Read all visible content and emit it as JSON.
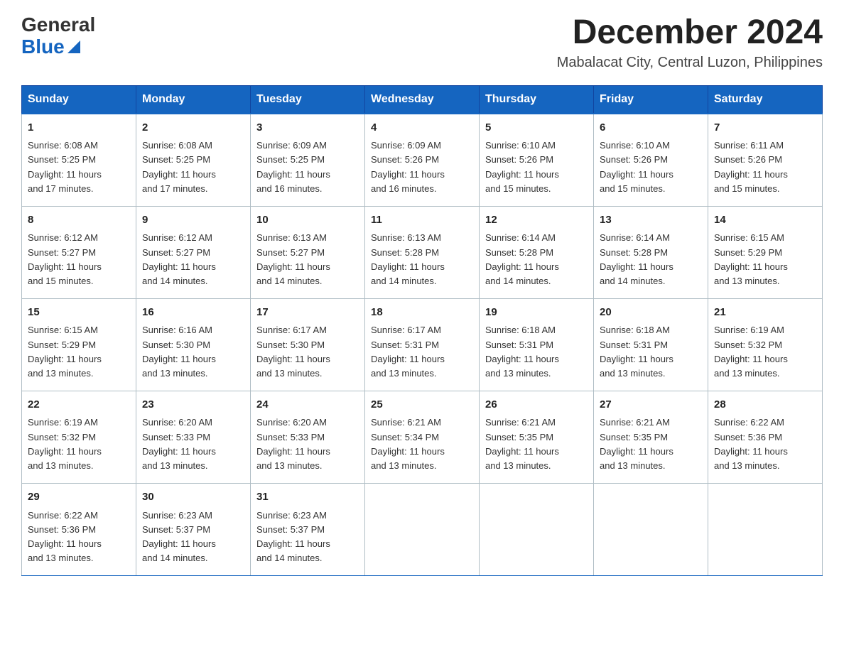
{
  "logo": {
    "general": "General",
    "blue": "Blue"
  },
  "title": {
    "month_year": "December 2024",
    "location": "Mabalacat City, Central Luzon, Philippines"
  },
  "headers": [
    "Sunday",
    "Monday",
    "Tuesday",
    "Wednesday",
    "Thursday",
    "Friday",
    "Saturday"
  ],
  "weeks": [
    [
      {
        "day": "1",
        "sunrise": "6:08 AM",
        "sunset": "5:25 PM",
        "daylight": "11 hours and 17 minutes."
      },
      {
        "day": "2",
        "sunrise": "6:08 AM",
        "sunset": "5:25 PM",
        "daylight": "11 hours and 17 minutes."
      },
      {
        "day": "3",
        "sunrise": "6:09 AM",
        "sunset": "5:25 PM",
        "daylight": "11 hours and 16 minutes."
      },
      {
        "day": "4",
        "sunrise": "6:09 AM",
        "sunset": "5:26 PM",
        "daylight": "11 hours and 16 minutes."
      },
      {
        "day": "5",
        "sunrise": "6:10 AM",
        "sunset": "5:26 PM",
        "daylight": "11 hours and 15 minutes."
      },
      {
        "day": "6",
        "sunrise": "6:10 AM",
        "sunset": "5:26 PM",
        "daylight": "11 hours and 15 minutes."
      },
      {
        "day": "7",
        "sunrise": "6:11 AM",
        "sunset": "5:26 PM",
        "daylight": "11 hours and 15 minutes."
      }
    ],
    [
      {
        "day": "8",
        "sunrise": "6:12 AM",
        "sunset": "5:27 PM",
        "daylight": "11 hours and 15 minutes."
      },
      {
        "day": "9",
        "sunrise": "6:12 AM",
        "sunset": "5:27 PM",
        "daylight": "11 hours and 14 minutes."
      },
      {
        "day": "10",
        "sunrise": "6:13 AM",
        "sunset": "5:27 PM",
        "daylight": "11 hours and 14 minutes."
      },
      {
        "day": "11",
        "sunrise": "6:13 AM",
        "sunset": "5:28 PM",
        "daylight": "11 hours and 14 minutes."
      },
      {
        "day": "12",
        "sunrise": "6:14 AM",
        "sunset": "5:28 PM",
        "daylight": "11 hours and 14 minutes."
      },
      {
        "day": "13",
        "sunrise": "6:14 AM",
        "sunset": "5:28 PM",
        "daylight": "11 hours and 14 minutes."
      },
      {
        "day": "14",
        "sunrise": "6:15 AM",
        "sunset": "5:29 PM",
        "daylight": "11 hours and 13 minutes."
      }
    ],
    [
      {
        "day": "15",
        "sunrise": "6:15 AM",
        "sunset": "5:29 PM",
        "daylight": "11 hours and 13 minutes."
      },
      {
        "day": "16",
        "sunrise": "6:16 AM",
        "sunset": "5:30 PM",
        "daylight": "11 hours and 13 minutes."
      },
      {
        "day": "17",
        "sunrise": "6:17 AM",
        "sunset": "5:30 PM",
        "daylight": "11 hours and 13 minutes."
      },
      {
        "day": "18",
        "sunrise": "6:17 AM",
        "sunset": "5:31 PM",
        "daylight": "11 hours and 13 minutes."
      },
      {
        "day": "19",
        "sunrise": "6:18 AM",
        "sunset": "5:31 PM",
        "daylight": "11 hours and 13 minutes."
      },
      {
        "day": "20",
        "sunrise": "6:18 AM",
        "sunset": "5:31 PM",
        "daylight": "11 hours and 13 minutes."
      },
      {
        "day": "21",
        "sunrise": "6:19 AM",
        "sunset": "5:32 PM",
        "daylight": "11 hours and 13 minutes."
      }
    ],
    [
      {
        "day": "22",
        "sunrise": "6:19 AM",
        "sunset": "5:32 PM",
        "daylight": "11 hours and 13 minutes."
      },
      {
        "day": "23",
        "sunrise": "6:20 AM",
        "sunset": "5:33 PM",
        "daylight": "11 hours and 13 minutes."
      },
      {
        "day": "24",
        "sunrise": "6:20 AM",
        "sunset": "5:33 PM",
        "daylight": "11 hours and 13 minutes."
      },
      {
        "day": "25",
        "sunrise": "6:21 AM",
        "sunset": "5:34 PM",
        "daylight": "11 hours and 13 minutes."
      },
      {
        "day": "26",
        "sunrise": "6:21 AM",
        "sunset": "5:35 PM",
        "daylight": "11 hours and 13 minutes."
      },
      {
        "day": "27",
        "sunrise": "6:21 AM",
        "sunset": "5:35 PM",
        "daylight": "11 hours and 13 minutes."
      },
      {
        "day": "28",
        "sunrise": "6:22 AM",
        "sunset": "5:36 PM",
        "daylight": "11 hours and 13 minutes."
      }
    ],
    [
      {
        "day": "29",
        "sunrise": "6:22 AM",
        "sunset": "5:36 PM",
        "daylight": "11 hours and 13 minutes."
      },
      {
        "day": "30",
        "sunrise": "6:23 AM",
        "sunset": "5:37 PM",
        "daylight": "11 hours and 14 minutes."
      },
      {
        "day": "31",
        "sunrise": "6:23 AM",
        "sunset": "5:37 PM",
        "daylight": "11 hours and 14 minutes."
      },
      null,
      null,
      null,
      null
    ]
  ],
  "labels": {
    "sunrise": "Sunrise:",
    "sunset": "Sunset:",
    "daylight": "Daylight:"
  }
}
